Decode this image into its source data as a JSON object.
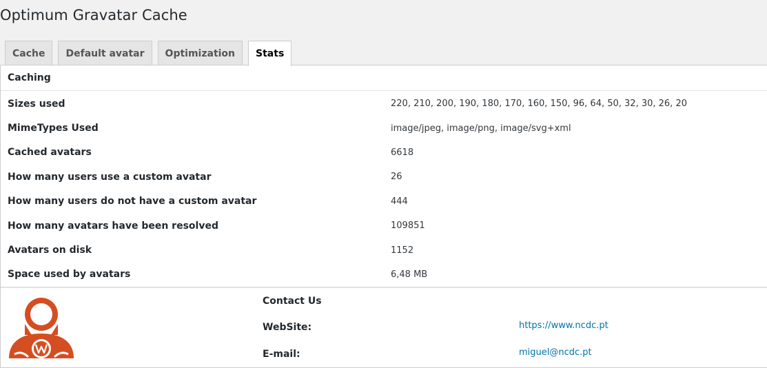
{
  "page": {
    "title": "Optimum Gravatar Cache"
  },
  "tabs": [
    {
      "label": "Cache",
      "active": false
    },
    {
      "label": "Default avatar",
      "active": false
    },
    {
      "label": "Optimization",
      "active": false
    },
    {
      "label": "Stats",
      "active": true
    }
  ],
  "caching": {
    "heading": "Caching",
    "rows": [
      {
        "label": "Sizes used",
        "value": "220, 210, 200, 190, 180, 170, 160, 150, 96, 64, 50, 32, 30, 26, 20"
      },
      {
        "label": "MimeTypes Used",
        "value": "image/jpeg, image/png, image/svg+xml"
      },
      {
        "label": "Cached avatars",
        "value": "6618"
      },
      {
        "label": "How many users use a custom avatar",
        "value": "26"
      },
      {
        "label": "How many users do not have a custom avatar",
        "value": "444"
      },
      {
        "label": "How many avatars have been resolved",
        "value": "109851"
      },
      {
        "label": "Avatars on disk",
        "value": "1152"
      },
      {
        "label": "Space used by avatars",
        "value": "6,48 MB"
      }
    ]
  },
  "contact": {
    "heading": "Contact Us",
    "website_label": "WebSite:",
    "website_value": "https://www.ncdc.pt",
    "email_label": "E-mail:",
    "email_value": "miguel@ncdc.pt"
  },
  "colors": {
    "accent": "#d54e21",
    "link": "#0073aa"
  },
  "icons": {
    "logo": "wordpress-avatar-logo-icon"
  }
}
